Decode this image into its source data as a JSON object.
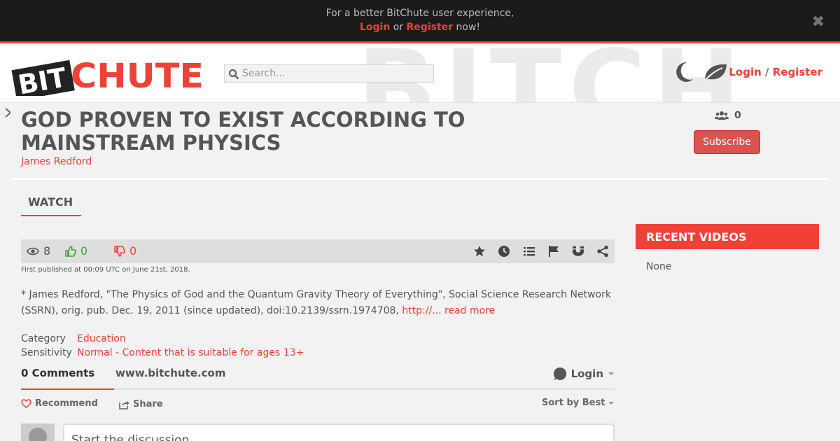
{
  "banner": {
    "text_line1": "For a better BitChute user experience,",
    "login_label": "Login",
    "or_text": " or ",
    "register_label": "Register",
    "now_text": " now!",
    "close_glyph": "✖"
  },
  "header": {
    "search_placeholder": "Search...",
    "login_label": "Login",
    "separator": " / ",
    "register_label": "Register",
    "icons": [
      "moon-icon",
      "leaf-icon",
      "search-icon"
    ]
  },
  "video": {
    "title": "GOD PROVEN TO EXIST ACCORDING TO MAINSTREAM PHYSICS",
    "channel": "James Redford",
    "subscriber_count": "0",
    "subscribe_label": "Subscribe",
    "tab_label": "WATCH",
    "views": "8",
    "likes": "0",
    "dislikes": "0",
    "published": "First published at 00:09 UTC on June 21st, 2018.",
    "description": "* James Redford, \"The Physics of God and the Quantum Gravity Theory of Everything\", Social Science Research Network (SSRN), orig. pub. Dec. 19, 2011 (since updated), doi:10.2139/ssrn.1974708, ",
    "description_link": "http://...",
    "read_more": " read more",
    "category_label": "Category",
    "category_value": "Education",
    "sensitivity_label": "Sensitivity",
    "sensitivity_value": "Normal - Content that is suitable for ages 13+"
  },
  "comments": {
    "count_label": "0 Comments",
    "site": "www.bitchute.com",
    "login_label": "Login",
    "recommend_label": "Recommend",
    "share_label": "Share",
    "sort_label": "Sort by Best",
    "input_placeholder": "Start the discussion..."
  },
  "sidebar": {
    "recent_title": "RECENT VIDEOS",
    "recent_empty": "None"
  },
  "colors": {
    "accent": "#ef4136",
    "banner_bg": "#1b1b1b",
    "subscribe_bg": "#d9534f",
    "like_green": "#3fa535"
  }
}
